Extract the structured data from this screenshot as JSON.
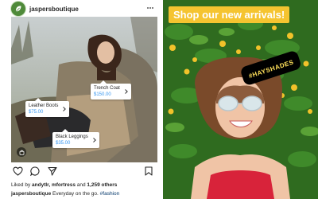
{
  "post": {
    "username": "jaspersboutique",
    "tags": [
      {
        "name": "Trench Coat",
        "price": "$150.00"
      },
      {
        "name": "Leather Boots",
        "price": "$75.00"
      },
      {
        "name": "Black Leggings",
        "price": "$35.00"
      }
    ],
    "likes": {
      "prefix": "Liked by ",
      "users": "andytlr, mfortress",
      "middle": " and ",
      "others": "1,259 others"
    },
    "caption": {
      "user": "jaspersboutique",
      "text": " Everyday on the go. ",
      "hashtag": "#fashion"
    }
  },
  "story": {
    "banner": "Shop our new arrivals!",
    "sticker": "#HAYSHADES"
  },
  "icons": [
    "brand-logo-icon",
    "more-icon",
    "shopping-bag-icon",
    "chevron-right-icon",
    "heart-icon",
    "comment-icon",
    "share-icon",
    "bookmark-icon"
  ],
  "colors": {
    "accent_blue": "#3897f0",
    "banner_yellow": "#f5c430",
    "text": "#262626",
    "hashtag": "#003569"
  }
}
